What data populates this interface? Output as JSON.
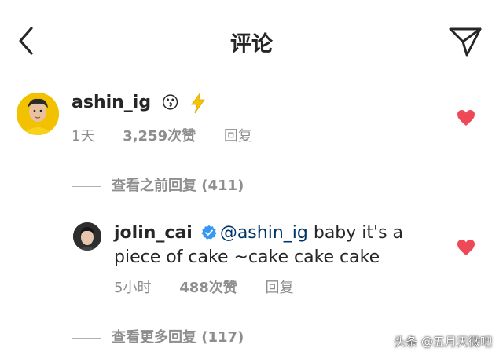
{
  "header": {
    "title": "评论",
    "back_icon": "chevron-left-icon",
    "send_icon": "paper-plane-icon"
  },
  "comments": [
    {
      "username": "ashin_ig",
      "emoji": "😗",
      "extra_icon": "lightning-bolt-icon",
      "time": "1天",
      "likes": "3,259次赞",
      "reply": "回复",
      "liked": true
    }
  ],
  "view_previous": "查看之前回复 (411)",
  "replies": [
    {
      "username": "jolin_cai",
      "verified": true,
      "mention": "@ashin_ig",
      "text_line1": " baby it's a",
      "text_line2": "piece of cake ~cake cake cake",
      "time": "5小时",
      "likes": "488次赞",
      "reply": "回复",
      "liked": true
    }
  ],
  "view_more": "查看更多回复 (117)",
  "watermark": "头条 @五月天微吧",
  "colors": {
    "heart": "#ed4956",
    "mention": "#003569",
    "meta": "#8e8e8e",
    "verified": "#3897f0",
    "bolt": "#f6c400"
  }
}
